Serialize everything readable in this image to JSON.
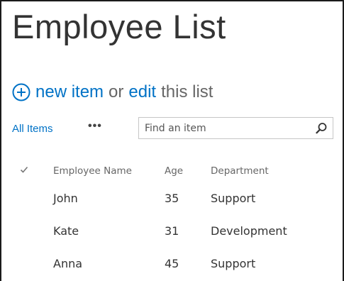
{
  "page": {
    "title": "Employee List"
  },
  "actions": {
    "new_item_label": "new item",
    "or_text": "or",
    "edit_label": "edit",
    "this_list_text": "this list"
  },
  "view": {
    "all_items_label": "All Items",
    "more_label": "•••"
  },
  "search": {
    "placeholder": "Find an item",
    "value": ""
  },
  "table": {
    "columns": {
      "name": "Employee Name",
      "age": "Age",
      "department": "Department"
    },
    "rows": [
      {
        "name": "John",
        "age": "35",
        "department": "Support"
      },
      {
        "name": "Kate",
        "age": "31",
        "department": "Development"
      },
      {
        "name": "Anna",
        "age": "45",
        "department": "Support"
      }
    ]
  },
  "colors": {
    "link": "#0072c6",
    "text": "#333333",
    "muted": "#666666",
    "border": "#c6c6c6"
  },
  "icons": {
    "add": "plus-circle-icon",
    "search": "search-icon",
    "select_all": "checkmark-icon"
  }
}
